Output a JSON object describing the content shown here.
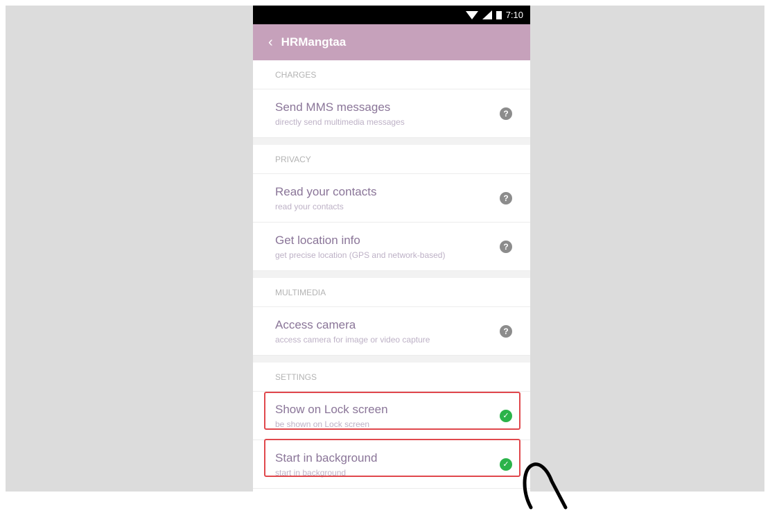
{
  "status_bar": {
    "time": "7:10"
  },
  "app_bar": {
    "title": "HRMangtaa"
  },
  "sections": [
    {
      "header": "CHARGES",
      "items": [
        {
          "title": "Send MMS messages",
          "subtitle": "directly send multimedia messages",
          "state": "help"
        }
      ]
    },
    {
      "header": "PRIVACY",
      "items": [
        {
          "title": "Read your contacts",
          "subtitle": "read your contacts",
          "state": "help"
        },
        {
          "title": "Get location info",
          "subtitle": "get precise location (GPS and network-based)",
          "state": "help"
        }
      ]
    },
    {
      "header": "MULTIMEDIA",
      "items": [
        {
          "title": "Access camera",
          "subtitle": "access camera for image or video capture",
          "state": "help"
        }
      ]
    },
    {
      "header": "SETTINGS",
      "items": [
        {
          "title": "Show on Lock screen",
          "subtitle": "be shown on Lock screen",
          "state": "enabled"
        },
        {
          "title": "Start in background",
          "subtitle": "start in background",
          "state": "enabled"
        }
      ]
    }
  ],
  "icons": {
    "help": "question-mark-icon",
    "enabled": "check-icon"
  },
  "colors": {
    "app_bar": "#c6a1bb",
    "highlight": "#e0474c",
    "enabled": "#2bb34a"
  }
}
